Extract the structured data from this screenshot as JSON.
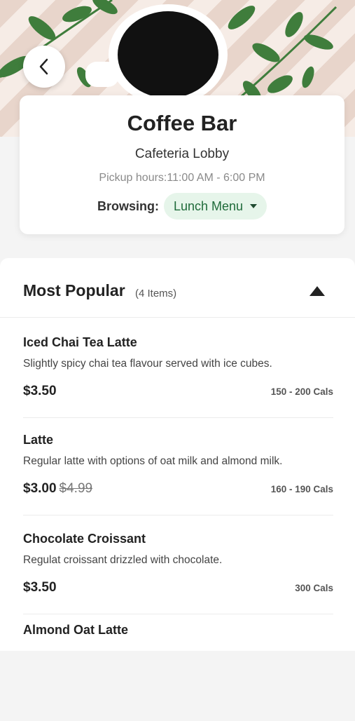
{
  "store": {
    "title": "Coffee Bar",
    "location": "Cafeteria Lobby",
    "hours": "Pickup hours:11:00 AM - 6:00 PM",
    "browsing_label": "Browsing:",
    "menu_selected": "Lunch Menu"
  },
  "section": {
    "title": "Most Popular",
    "count": "(4 Items)"
  },
  "items": [
    {
      "name": "Iced Chai Tea Latte",
      "description": "Slightly spicy chai tea flavour served with ice cubes.",
      "price": "$3.50",
      "old_price": "",
      "calories": "150 - 200 Cals"
    },
    {
      "name": "Latte",
      "description": "Regular latte with options of oat milk and almond milk.",
      "price": "$3.00",
      "old_price": "$4.99",
      "calories": "160 - 190 Cals"
    },
    {
      "name": "Chocolate Croissant",
      "description": "Regulat croissant drizzled with chocolate.",
      "price": "$3.50",
      "old_price": "",
      "calories": "300 Cals"
    },
    {
      "name": "Almond Oat Latte",
      "description": "",
      "price": "",
      "old_price": "",
      "calories": ""
    }
  ],
  "icons": {
    "back": "chevron-left-icon",
    "dropdown": "caret-down-icon",
    "collapse": "triangle-up-icon"
  },
  "colors": {
    "accent_green": "#1f6b3a",
    "pill_bg": "#e6f5ea"
  }
}
